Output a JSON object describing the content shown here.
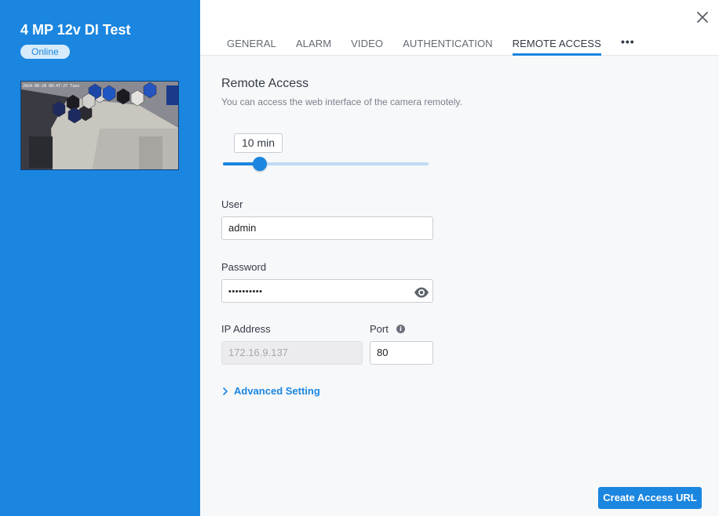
{
  "camera": {
    "title": "4 MP 12v DI Test",
    "status": "Online",
    "preview_timestamp": "2024-08-28 08:47:27 Tues"
  },
  "tabs": [
    {
      "label": "GENERAL",
      "active": false
    },
    {
      "label": "ALARM",
      "active": false
    },
    {
      "label": "VIDEO",
      "active": false
    },
    {
      "label": "AUTHENTICATION",
      "active": false
    },
    {
      "label": "REMOTE ACCESS",
      "active": true
    }
  ],
  "tabs_more": "•••",
  "remote_access": {
    "title": "Remote Access",
    "subtitle": "You can access the web interface of the camera remotely.",
    "duration_label": "10 min",
    "duration_fraction": 0.18,
    "user_label": "User",
    "user_value": "admin",
    "password_label": "Password",
    "password_masked": "••••••••••",
    "ip_label": "IP Address",
    "ip_value": "172.16.9.137",
    "port_label": "Port",
    "port_value": "80",
    "advanced_label": "Advanced Setting",
    "create_button": "Create Access URL"
  },
  "icons": {
    "close": "close-icon",
    "eye": "eye-icon",
    "info": "info-icon",
    "chevron": "chevron-right-icon"
  },
  "colors": {
    "accent": "#1a86e0",
    "panel_bg": "#f7f8fa"
  }
}
